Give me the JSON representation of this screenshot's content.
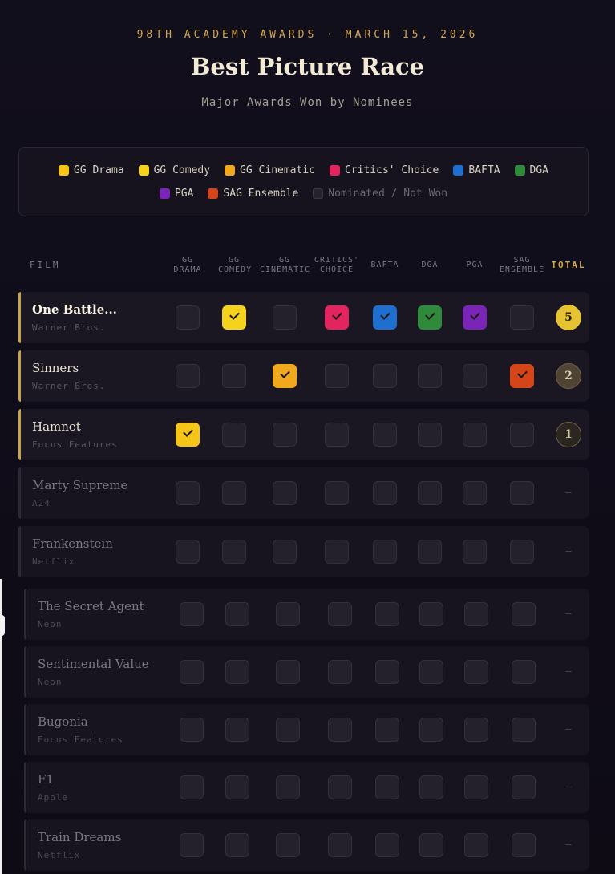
{
  "header": {
    "kicker": "98TH ACADEMY AWARDS · MARCH 15, 2026",
    "title": "Best Picture Race",
    "subtitle": "Major Awards Won by Nominees"
  },
  "legend": [
    {
      "label": "GG Drama",
      "color": "#f5c518"
    },
    {
      "label": "GG Comedy",
      "color": "#f5d21b"
    },
    {
      "label": "GG Cinematic",
      "color": "#f0a81c"
    },
    {
      "label": "Critics' Choice",
      "color": "#e3245e"
    },
    {
      "label": "BAFTA",
      "color": "#1e6fd0"
    },
    {
      "label": "DGA",
      "color": "#2f8a3b"
    },
    {
      "label": "PGA",
      "color": "#7a24b8"
    },
    {
      "label": "SAG Ensemble",
      "color": "#d4461a"
    },
    {
      "label": "Nominated / Not Won",
      "color": "#26232f"
    }
  ],
  "chart_data": {
    "type": "table",
    "columns": [
      "FILM",
      "GG DRAMA",
      "GG COMEDY",
      "GG CINEMATIC",
      "CRITICS' CHOICE",
      "BAFTA",
      "DGA",
      "PGA",
      "SAG ENSEMBLE",
      "TOTAL"
    ],
    "award_colors": [
      "#f5c518",
      "#f5d21b",
      "#f0a81c",
      "#e3245e",
      "#1e6fd0",
      "#2f8a3b",
      "#7a24b8",
      "#d4461a"
    ],
    "rows": [
      {
        "film": "One Battle...",
        "studio": "Warner Bros.",
        "wins": [
          0,
          1,
          0,
          1,
          1,
          1,
          1,
          0
        ],
        "total": "5"
      },
      {
        "film": "Sinners",
        "studio": "Warner Bros.",
        "wins": [
          0,
          0,
          1,
          0,
          0,
          0,
          0,
          1
        ],
        "total": "2"
      },
      {
        "film": "Hamnet",
        "studio": "Focus Features",
        "wins": [
          1,
          0,
          0,
          0,
          0,
          0,
          0,
          0
        ],
        "total": "1"
      },
      {
        "film": "Marty Supreme",
        "studio": "A24",
        "wins": [
          0,
          0,
          0,
          0,
          0,
          0,
          0,
          0
        ],
        "total": "–"
      },
      {
        "film": "Frankenstein",
        "studio": "Netflix",
        "wins": [
          0,
          0,
          0,
          0,
          0,
          0,
          0,
          0
        ],
        "total": "–"
      },
      {
        "film": "The Secret Agent",
        "studio": "Neon",
        "wins": [
          0,
          0,
          0,
          0,
          0,
          0,
          0,
          0
        ],
        "total": "–"
      },
      {
        "film": "Sentimental Value",
        "studio": "Neon",
        "wins": [
          0,
          0,
          0,
          0,
          0,
          0,
          0,
          0
        ],
        "total": "–"
      },
      {
        "film": "Bugonia",
        "studio": "Focus Features",
        "wins": [
          0,
          0,
          0,
          0,
          0,
          0,
          0,
          0
        ],
        "total": "–"
      },
      {
        "film": "F1",
        "studio": "Apple",
        "wins": [
          0,
          0,
          0,
          0,
          0,
          0,
          0,
          0
        ],
        "total": "–"
      },
      {
        "film": "Train Dreams",
        "studio": "Netflix",
        "wins": [
          0,
          0,
          0,
          0,
          0,
          0,
          0,
          0
        ],
        "total": "–"
      }
    ]
  }
}
